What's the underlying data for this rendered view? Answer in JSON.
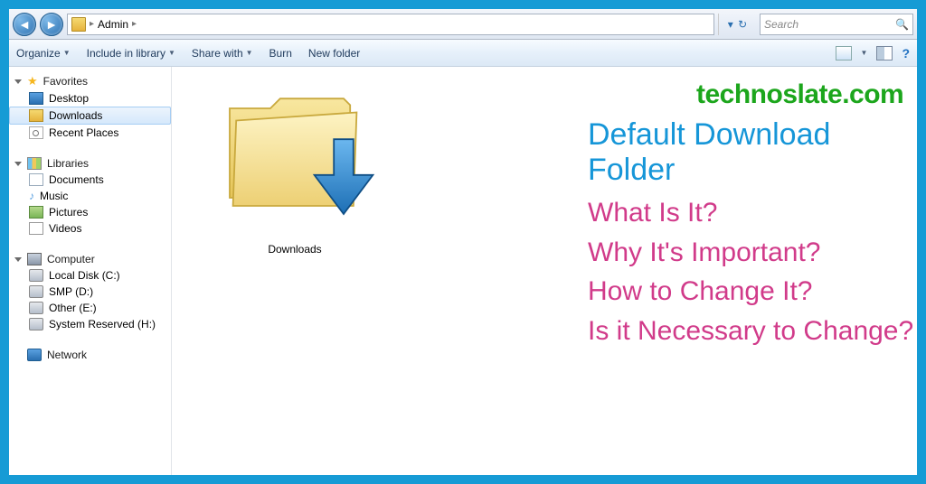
{
  "nav": {
    "breadcrumb_root": "Admin",
    "breadcrumb_sep": "▸",
    "search_placeholder": "Search"
  },
  "toolbar": {
    "organize": "Organize",
    "include": "Include in library",
    "share": "Share with",
    "burn": "Burn",
    "newfolder": "New folder"
  },
  "sidebar": {
    "favorites": {
      "label": "Favorites",
      "items": [
        "Desktop",
        "Downloads",
        "Recent Places"
      ],
      "selected": 1
    },
    "libraries": {
      "label": "Libraries",
      "items": [
        "Documents",
        "Music",
        "Pictures",
        "Videos"
      ]
    },
    "computer": {
      "label": "Computer",
      "items": [
        "Local Disk (C:)",
        "SMP (D:)",
        "Other (E:)",
        "System Reserved (H:)"
      ]
    },
    "network": {
      "label": "Network"
    }
  },
  "content": {
    "folder_label": "Downloads"
  },
  "overlay": {
    "brand": "technoslate.com",
    "headline": "Default Download Folder",
    "q1": "What Is It?",
    "q2": "Why It's Important?",
    "q3": "How to Change It?",
    "q4": "Is it Necessary to Change?"
  }
}
